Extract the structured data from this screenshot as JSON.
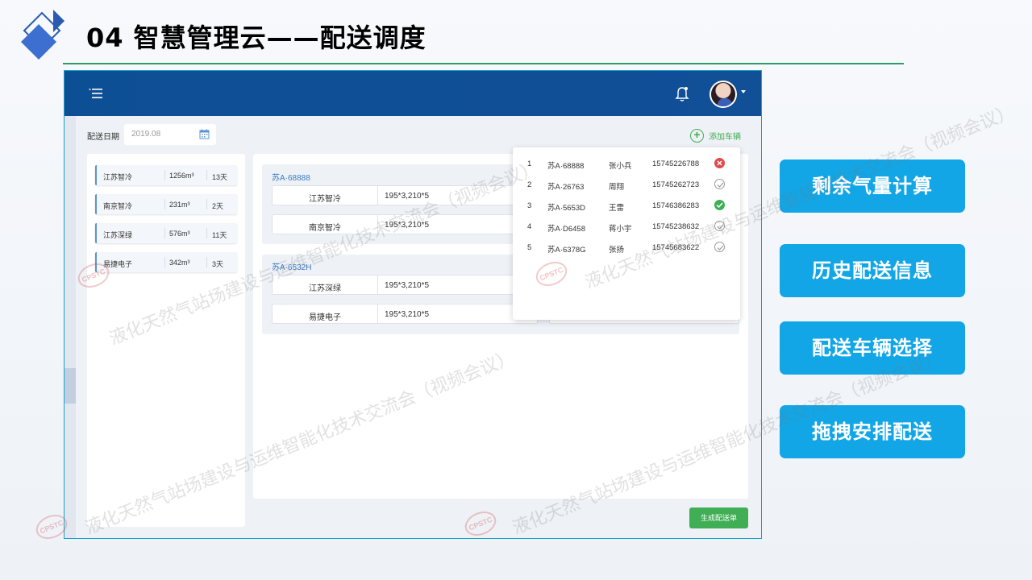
{
  "slide": {
    "title": "04 智慧管理云——配送调度"
  },
  "app": {
    "date_label": "配送日期",
    "date_value": "2019.08",
    "add_vehicle_label": "添加车辆",
    "generate_button_label": "生成配送单",
    "companies": [
      {
        "name": "江苏智冷",
        "volume": "1256m³",
        "days": "13天"
      },
      {
        "name": "南京智冷",
        "volume": "231m³",
        "days": "2天"
      },
      {
        "name": "江苏深绿",
        "volume": "576m³",
        "days": "11天"
      },
      {
        "name": "易捷电子",
        "volume": "342m³",
        "days": "3天"
      }
    ],
    "routes": [
      {
        "plate": "苏A·68888",
        "rows": [
          {
            "company": "江苏智冷",
            "spec": "195*3,210*5"
          },
          {
            "company": "南京智冷",
            "spec": "195*3,210*5"
          }
        ]
      },
      {
        "plate": "苏A·6532H",
        "rows": [
          {
            "company": "江苏深绿",
            "spec": "195*3,210*5"
          },
          {
            "company": "易捷电子",
            "spec": "195*3,210*5"
          }
        ]
      }
    ],
    "vehicles": [
      {
        "no": "1",
        "plate": "苏A·68888",
        "driver": "张小兵",
        "phone": "15745226788",
        "status": "error"
      },
      {
        "no": "2",
        "plate": "苏A·26763",
        "driver": "周翔",
        "phone": "15745262723",
        "status": "idle"
      },
      {
        "no": "3",
        "plate": "苏A·5653D",
        "driver": "王雷",
        "phone": "15746386283",
        "status": "ok"
      },
      {
        "no": "4",
        "plate": "苏A·D6458",
        "driver": "蒋小宇",
        "phone": "15745238632",
        "status": "idle"
      },
      {
        "no": "5",
        "plate": "苏A·6378G",
        "driver": "张扬",
        "phone": "15745683622",
        "status": "idle"
      }
    ],
    "icons": {
      "menu": "menu-icon",
      "bell": "bell-icon",
      "calendar": "calendar-icon",
      "add": "plus-circle-icon"
    }
  },
  "features": [
    {
      "label": "剩余气量计算"
    },
    {
      "label": "历史配送信息"
    },
    {
      "label": "配送车辆选择"
    },
    {
      "label": "拖拽安排配送"
    }
  ],
  "watermark": {
    "text": "液化天然气站场建设与运维智能化技术交流会（视频会议）",
    "seal": "CPSTC"
  },
  "colors": {
    "topbar": "#0d4f95",
    "accent_green": "#3fae55",
    "feature_blue": "#12a6e6",
    "title_rule": "#2f9a6a"
  }
}
